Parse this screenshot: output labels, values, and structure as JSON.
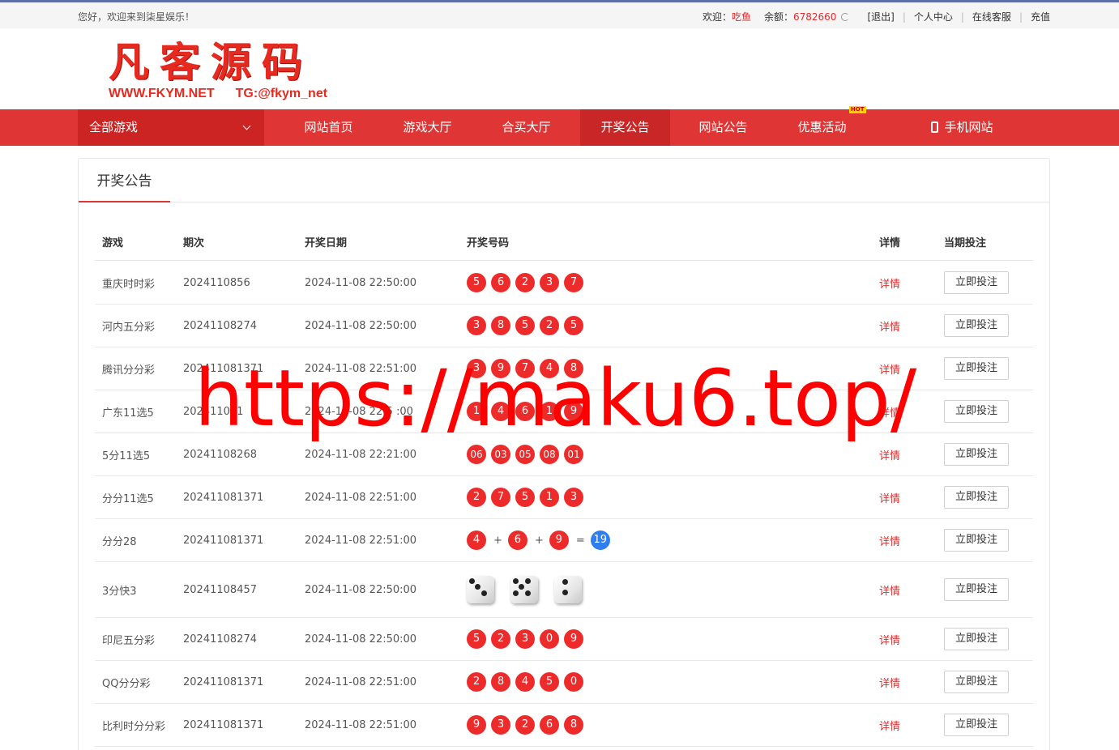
{
  "topbar": {
    "welcome": "您好，欢迎来到柒星娱乐！",
    "greet_label": "欢迎：",
    "username": "吃鱼",
    "balance_label": "余额：",
    "balance": "6782660",
    "logout": "[退出]",
    "user_center": "个人中心",
    "service": "在线客服",
    "recharge": "充值"
  },
  "logo": {
    "big": "凡客源码",
    "site": "WWW.FKYM.NET",
    "tg": "TG:@fkym_net"
  },
  "nav": {
    "all_games": "全部游戏",
    "items": [
      "网站首页",
      "游戏大厅",
      "合买大厅",
      "开奖公告",
      "网站公告",
      "优惠活动"
    ],
    "hot": "HOT",
    "mobile": "手机网站",
    "active": "开奖公告"
  },
  "panel": {
    "title": "开奖公告"
  },
  "table": {
    "headers": {
      "game": "游戏",
      "issue": "期次",
      "date": "开奖日期",
      "nums": "开奖号码",
      "detail": "详情",
      "bet": "当期投注"
    },
    "rows": [
      {
        "game": "重庆时时彩",
        "issue": "2024110856",
        "date": "2024-11-08 22:50:00",
        "kind": "balls",
        "nums": [
          "5",
          "6",
          "2",
          "3",
          "7"
        ],
        "detail": "详情",
        "bet": "立即投注"
      },
      {
        "game": "河内五分彩",
        "issue": "20241108274",
        "date": "2024-11-08 22:50:00",
        "kind": "balls",
        "nums": [
          "3",
          "8",
          "5",
          "2",
          "5"
        ],
        "detail": "详情",
        "bet": "立即投注"
      },
      {
        "game": "腾讯分分彩",
        "issue": "202411081371",
        "date": "2024-11-08 22:51:00",
        "kind": "balls",
        "nums": [
          "3",
          "9",
          "7",
          "4",
          "8"
        ],
        "detail": "详情",
        "bet": "立即投注"
      },
      {
        "game": "广东11选5",
        "issue": "202411081",
        "date": "2024-11-08 22:5 :00",
        "kind": "balls",
        "nums": [
          "1",
          "4",
          "6",
          "1",
          "9"
        ],
        "detail": "详情",
        "bet": "立即投注"
      },
      {
        "game": "5分11选5",
        "issue": "20241108268",
        "date": "2024-11-08 22:21:00",
        "kind": "balls",
        "nums": [
          "06",
          "03",
          "05",
          "08",
          "01"
        ],
        "detail": "详情",
        "bet": "立即投注"
      },
      {
        "game": "分分11选5",
        "issue": "202411081371",
        "date": "2024-11-08 22:51:00",
        "kind": "balls",
        "nums": [
          "2",
          "7",
          "5",
          "1",
          "3"
        ],
        "detail": "详情",
        "bet": "立即投注"
      },
      {
        "game": "分分28",
        "issue": "202411081371",
        "date": "2024-11-08 22:51:00",
        "kind": "sum",
        "nums": [
          "4",
          "6",
          "9"
        ],
        "sum": "19",
        "plus": "+",
        "equals": "=",
        "detail": "详情",
        "bet": "立即投注"
      },
      {
        "game": "3分快3",
        "issue": "20241108457",
        "date": "2024-11-08 22:50:00",
        "kind": "dice",
        "nums": [
          3,
          5,
          2
        ],
        "detail": "详情",
        "bet": "立即投注"
      },
      {
        "game": "印尼五分彩",
        "issue": "20241108274",
        "date": "2024-11-08 22:50:00",
        "kind": "balls",
        "nums": [
          "5",
          "2",
          "3",
          "0",
          "9"
        ],
        "detail": "详情",
        "bet": "立即投注"
      },
      {
        "game": "QQ分分彩",
        "issue": "202411081371",
        "date": "2024-11-08 22:51:00",
        "kind": "balls",
        "nums": [
          "2",
          "8",
          "4",
          "5",
          "0"
        ],
        "detail": "详情",
        "bet": "立即投注"
      },
      {
        "game": "比利时分分彩",
        "issue": "202411081371",
        "date": "2024-11-08 22:51:00",
        "kind": "balls",
        "nums": [
          "9",
          "3",
          "2",
          "6",
          "8"
        ],
        "detail": "详情",
        "bet": "立即投注"
      }
    ]
  },
  "watermark": "https://maku6.top/",
  "colors": {
    "brand_red": "#e03535",
    "ball_red": "#ee2b2b",
    "ball_blue": "#2f7ef0"
  }
}
